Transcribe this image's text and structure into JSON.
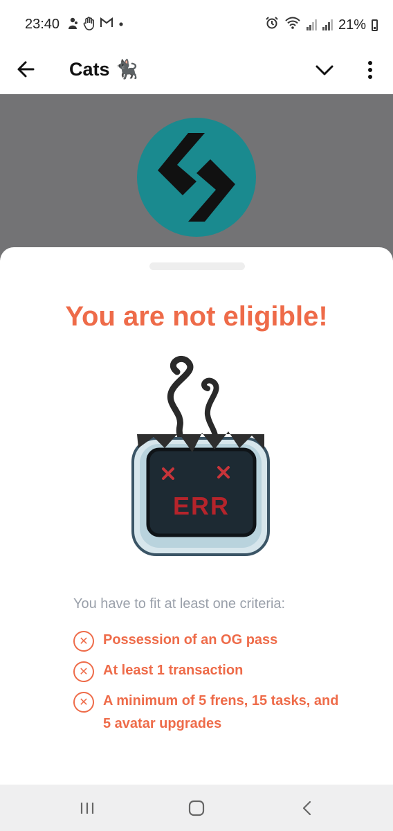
{
  "status_bar": {
    "time": "23:40",
    "left_icons": [
      "person-icon",
      "hand-icon",
      "gmail-icon",
      "dot-icon"
    ],
    "right_icons": [
      "alarm-icon",
      "wifi-icon",
      "signal-icon",
      "signal-icon"
    ],
    "battery": "21%"
  },
  "app_bar": {
    "title": "Cats 🐈‍⬛",
    "back_icon": "arrow-left-icon",
    "dropdown_icon": "chevron-down-icon",
    "more_icon": "more-vertical-icon"
  },
  "header": {
    "logo": "bitget-logo",
    "background_color": "#737375",
    "logo_color": "#1a8a8f"
  },
  "sheet": {
    "title": "You are not eligible!",
    "illustration": "broken-computer-err-icon",
    "illustration_text": "ERR",
    "intro": "You have to fit at least one criteria:",
    "criteria": [
      {
        "text": "Possession of an OG pass",
        "icon": "x-circle-icon"
      },
      {
        "text": "At least 1 transaction",
        "icon": "x-circle-icon"
      },
      {
        "text": "A minimum of 5 frens, 15 tasks, and 5 avatar upgrades",
        "icon": "x-circle-icon"
      }
    ],
    "accent_color": "#ee6b49"
  },
  "nav_bar": {
    "recents_icon": "recents-icon",
    "home_icon": "home-icon",
    "back_icon": "chevron-left-icon"
  }
}
